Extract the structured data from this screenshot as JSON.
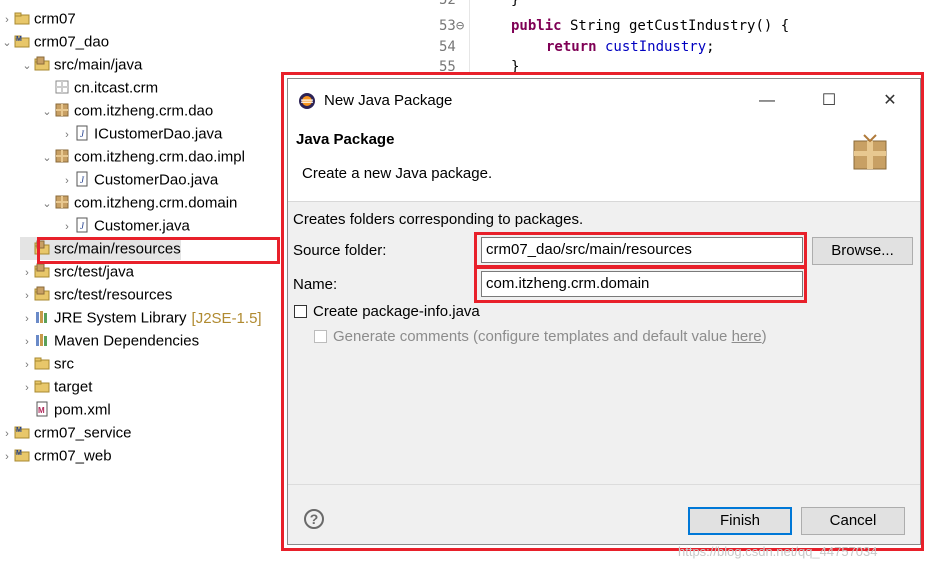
{
  "tree": [
    {
      "arrow": "›",
      "icon": "project-icon",
      "label": "crm07",
      "indent": 0
    },
    {
      "arrow": "⌄",
      "icon": "maven-project-icon",
      "label": "crm07_dao",
      "indent": 0
    },
    {
      "arrow": "⌄",
      "icon": "source-folder-icon",
      "label": "src/main/java",
      "indent": 1
    },
    {
      "arrow": "",
      "icon": "package-empty-icon",
      "label": "cn.itcast.crm",
      "indent": 2
    },
    {
      "arrow": "⌄",
      "icon": "package-icon",
      "label": "com.itzheng.crm.dao",
      "indent": 2
    },
    {
      "arrow": "›",
      "icon": "java-file-icon",
      "label": "ICustomerDao.java",
      "indent": 3
    },
    {
      "arrow": "⌄",
      "icon": "package-icon",
      "label": "com.itzheng.crm.dao.impl",
      "indent": 2
    },
    {
      "arrow": "›",
      "icon": "java-file-icon",
      "label": "CustomerDao.java",
      "indent": 3
    },
    {
      "arrow": "⌄",
      "icon": "package-icon",
      "label": "com.itzheng.crm.domain",
      "indent": 2
    },
    {
      "arrow": "›",
      "icon": "java-file-icon",
      "label": "Customer.java",
      "indent": 3
    },
    {
      "arrow": "",
      "icon": "source-folder-icon",
      "label": "src/main/resources",
      "indent": 1,
      "selected": true
    },
    {
      "arrow": "›",
      "icon": "source-folder-icon",
      "label": "src/test/java",
      "indent": 1
    },
    {
      "arrow": "›",
      "icon": "source-folder-icon",
      "label": "src/test/resources",
      "indent": 1
    },
    {
      "arrow": "›",
      "icon": "library-icon",
      "label": "JRE System Library",
      "suffix": "[J2SE-1.5]",
      "indent": 1
    },
    {
      "arrow": "›",
      "icon": "library-icon",
      "label": "Maven Dependencies",
      "indent": 1
    },
    {
      "arrow": "›",
      "icon": "folder-icon",
      "label": "src",
      "indent": 1
    },
    {
      "arrow": "›",
      "icon": "folder-icon",
      "label": "target",
      "indent": 1
    },
    {
      "arrow": "",
      "icon": "pom-file-icon",
      "label": "pom.xml",
      "indent": 1
    },
    {
      "arrow": "›",
      "icon": "maven-project-icon",
      "label": "crm07_service",
      "indent": 0
    },
    {
      "arrow": "›",
      "icon": "maven-project-icon",
      "label": "crm07_web",
      "indent": 0
    }
  ],
  "editor": {
    "lines": [
      {
        "num": "52",
        "code": "}"
      },
      {
        "num": "53⊖",
        "code": "public String getCustIndustry() {"
      },
      {
        "num": "54",
        "code": "return custIndustry;"
      },
      {
        "num": "55",
        "code": "}"
      }
    ],
    "kw_public": "public",
    "type_string": " String getCustIndustry() {",
    "kw_return": "return",
    "field_name": " custIndustry",
    "semicolon": ";"
  },
  "dialog": {
    "title": "New Java Package",
    "minimize": "—",
    "maximize": "☐",
    "close": "✕",
    "banner_title": "Java Package",
    "banner_desc": "Create a new Java package.",
    "info": "Creates folders corresponding to packages.",
    "source_folder_label": "Source folder:",
    "source_folder_value": "crm07_dao/src/main/resources",
    "browse_label": "Browse...",
    "name_label": "Name:",
    "name_value": "com.itzheng.crm.domain",
    "create_info_label": "Create package-info.java",
    "create_info_checked": false,
    "generate_comments_label": "Generate comments (configure templates and default value ",
    "generate_comments_link": "here",
    "generate_comments_end": ")",
    "finish_label": "Finish",
    "cancel_label": "Cancel",
    "help_label": "?"
  },
  "watermark": "https://blog.csdn.net/qq_44757034",
  "colors": {
    "annotation": "#e8202a",
    "focus": "#0078d7",
    "keyword": "#7f0055",
    "field": "#0000c0"
  }
}
